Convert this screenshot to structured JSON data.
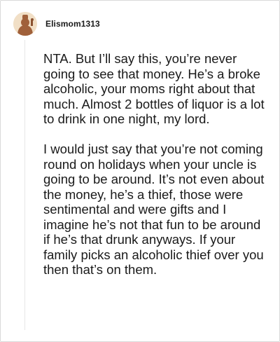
{
  "comment": {
    "username": "Elismom1313",
    "avatar_icon": "avatar-icon",
    "paragraphs": [
      "NTA. But I’ll say this, you’re never going to see that money. He’s a broke alcoholic, your moms right about that much. Almost 2 bottles of liquor is a lot to drink in one night, my lord.",
      "I would just say that you’re not coming round on holidays when your uncle is going to be around. It’s not even about the money, he’s a thief, those were sentimental and were gifts and I imagine he’s not that fun to be around if he’s that drunk anyways. If your family picks an alcoholic thief over you then that’s on them."
    ]
  },
  "colors": {
    "avatar_background": "#f1dfc6",
    "avatar_figure": "#a0603a",
    "text": "#1a1a1a",
    "border": "#d9d9d9"
  }
}
